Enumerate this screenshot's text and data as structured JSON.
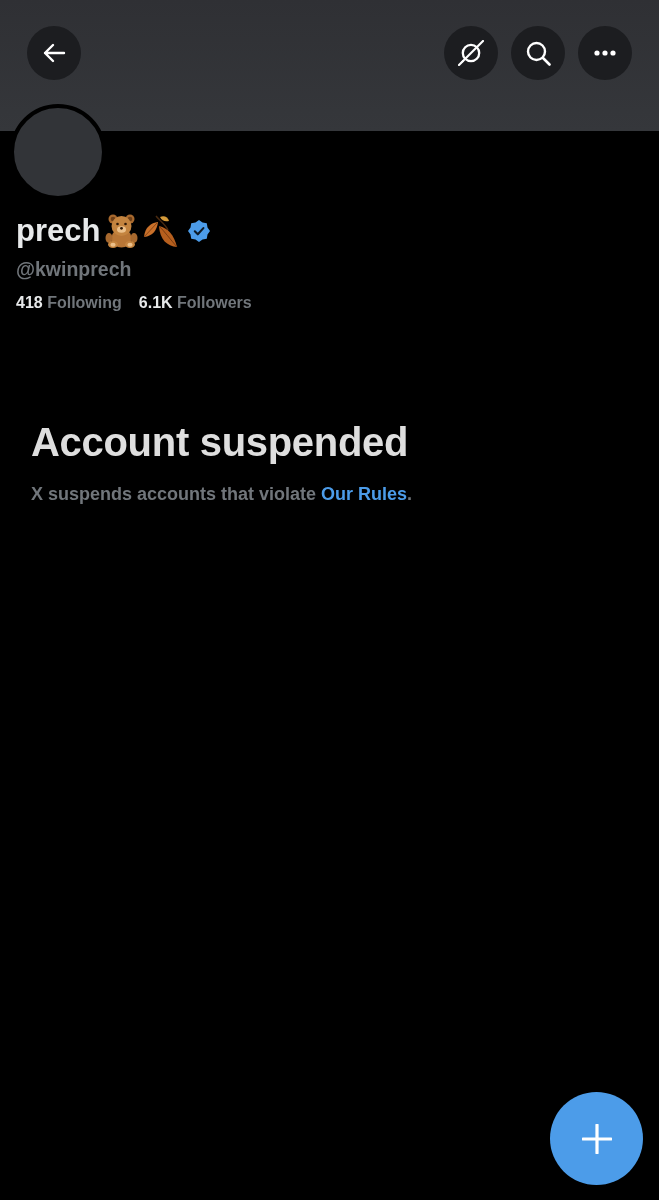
{
  "profile": {
    "display_name": "prech",
    "verified": true,
    "handle": "@kwinprech",
    "stats": [
      {
        "count": "418",
        "label": "Following"
      },
      {
        "count": "6.1K",
        "label": "Followers"
      }
    ]
  },
  "notice": {
    "title": "Account suspended",
    "message": {
      "text_before": "X suspends accounts that violate ",
      "link": "Our Rules",
      "text_after": "."
    }
  }
}
